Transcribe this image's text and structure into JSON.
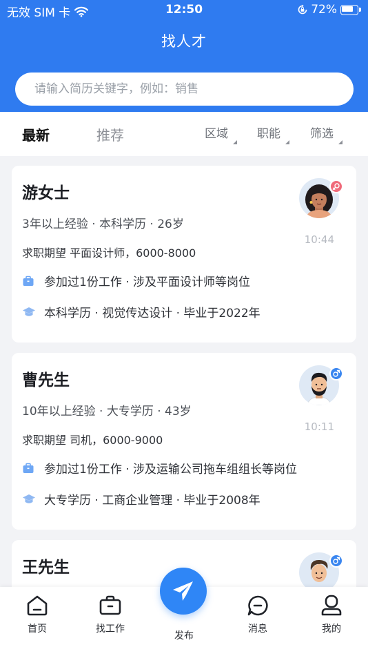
{
  "status_bar": {
    "carrier": "无效 SIM 卡",
    "time": "12:50",
    "battery": "72%",
    "battery_level": 0.72
  },
  "header": {
    "title": "找人才",
    "search_placeholder": "请输入简历关键字，例如：销售"
  },
  "tabs": {
    "latest": "最新",
    "recommend": "推荐"
  },
  "filters": {
    "region": "区域",
    "function": "职能",
    "screen": "筛选"
  },
  "candidates": [
    {
      "name": "游女士",
      "summary": "3年以上经验 · 本科学历 · 26岁",
      "expectation": "求职期望  平面设计师，6000-8000",
      "work": "参加过1份工作 · 涉及平面设计师等岗位",
      "education": "本科学历 · 视觉传达设计 · 毕业于2022年",
      "time": "10:44",
      "gender": "female"
    },
    {
      "name": "曹先生",
      "summary": "10年以上经验 · 大专学历 · 43岁",
      "expectation": "求职期望  司机，6000-9000",
      "work": "参加过1份工作 · 涉及运输公司拖车组组长等岗位",
      "education": "大专学历 · 工商企业管理 · 毕业于2008年",
      "time": "10:11",
      "gender": "male"
    },
    {
      "name": "王先生",
      "gender": "male"
    }
  ],
  "bottom_nav": {
    "home": "首页",
    "jobs": "找工作",
    "publish": "发布",
    "messages": "消息",
    "mine": "我的"
  },
  "colors": {
    "primary": "#2f7bf0",
    "female_badge": "#f06a7a",
    "male_badge": "#3a86f0",
    "work_icon": "#6ea7f5",
    "edu_icon": "#8fb8f2"
  }
}
